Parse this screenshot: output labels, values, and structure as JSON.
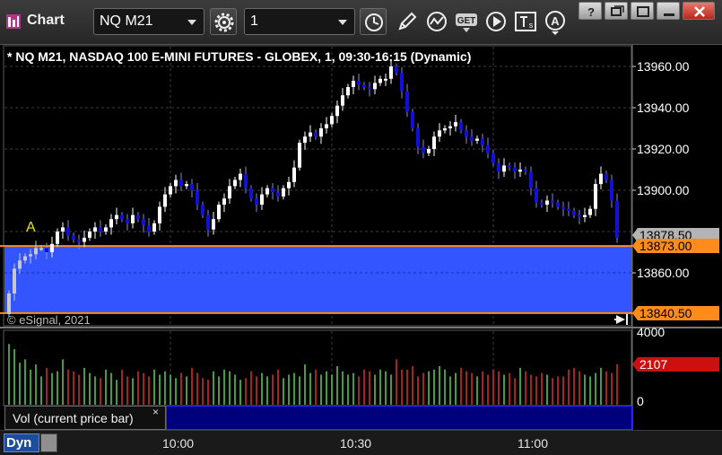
{
  "window": {
    "title": "Chart",
    "symbol": "NQ M21",
    "interval": "1"
  },
  "toolbar": {
    "icons": [
      "gear-icon",
      "clock-icon",
      "pencil-icon",
      "study-icon",
      "get-icon",
      "play-icon",
      "text-icon",
      "alert-icon"
    ]
  },
  "chart": {
    "title": "* NQ M21, NASDAQ 100 E-MINI FUTURES - GLOBEX, 1, 09:30-16:15 (Dynamic)",
    "copyright": "© eSignal, 2021",
    "annotation": "A",
    "price_labels": [
      "13960.00",
      "13940.00",
      "13920.00",
      "13900.00",
      "13860.00"
    ],
    "last_price": "13878.50",
    "line_price_1": "13873.00",
    "line_price_2": "13840.50",
    "volume_labels": [
      "4000",
      "0"
    ],
    "last_volume": "2107",
    "time_labels": [
      "10:00",
      "10:30",
      "11:00"
    ],
    "colors": {
      "up": "#ffffff",
      "down": "#1010d8",
      "zone": "#3355ff",
      "line": "#ff8c1a",
      "vol_up": "#5ad05a",
      "vol_down": "#d83030"
    }
  },
  "study": {
    "label": "Vol (current price bar)",
    "close": "×"
  },
  "status": {
    "mode": "Dyn"
  },
  "chart_data": {
    "type": "candlestick",
    "title": "* NQ M21, NASDAQ 100 E-MINI FUTURES - GLOBEX, 1, 09:30-16:15 (Dynamic)",
    "ylim": [
      13838,
      13967
    ],
    "y_ticks": [
      13960,
      13940,
      13920,
      13900,
      13860
    ],
    "x_ticks": [
      "10:00",
      "10:30",
      "11:00"
    ],
    "start_time": "09:30",
    "horizontal_lines": [
      13873.0,
      13840.5
    ],
    "shaded_zone": [
      13840.5,
      13873.0
    ],
    "last_price": 13878.5,
    "close": [
      13850,
      13862,
      13866,
      13868,
      13869,
      13872,
      13872,
      13870,
      13874,
      13880,
      13882,
      13878,
      13876,
      13875,
      13877,
      13880,
      13882,
      13880,
      13882,
      13886,
      13888,
      13886,
      13884,
      13888,
      13886,
      13883,
      13880,
      13884,
      13892,
      13898,
      13902,
      13905,
      13902,
      13903,
      13900,
      13893,
      13888,
      13881,
      13886,
      13893,
      13896,
      13902,
      13905,
      13908,
      13901,
      13896,
      13893,
      13898,
      13901,
      13899,
      13897,
      13901,
      13904,
      13911,
      13923,
      13926,
      13928,
      13926,
      13930,
      13932,
      13936,
      13941,
      13946,
      13950,
      13953,
      13951,
      13950,
      13949,
      13952,
      13954,
      13954,
      13960,
      13957,
      13948,
      13938,
      13930,
      13921,
      13918,
      13920,
      13926,
      13929,
      13930,
      13931,
      13933,
      13929,
      13926,
      13924,
      13925,
      13922,
      13918,
      13913,
      13909,
      13912,
      13911,
      13909,
      13910,
      13909,
      13901,
      13894,
      13893,
      13895,
      13894,
      13892,
      13891,
      13890,
      13888,
      13887,
      13888,
      13891,
      13903,
      13908,
      13905,
      13895,
      13877
    ],
    "volume_ylim": [
      0,
      4000
    ],
    "last_volume": 2107,
    "volume": [
      3300,
      3000,
      2200,
      2400,
      1800,
      2100,
      1400,
      1900,
      1600,
      1700,
      2400,
      1800,
      1700,
      1500,
      1900,
      1600,
      1400,
      1300,
      1800,
      1600,
      1200,
      1800,
      1400,
      1300,
      1700,
      1600,
      1400,
      1800,
      1500,
      1700,
      1500,
      1300,
      1600,
      1400,
      1900,
      1600,
      1300,
      1200,
      1700,
      1400,
      1800,
      1700,
      1500,
      1200,
      1300,
      1700,
      1400,
      1600,
      1400,
      1500,
      1800,
      1300,
      1500,
      1600,
      1400,
      2100,
      1600,
      1800,
      1500,
      1700,
      1500,
      2000,
      1700,
      1500,
      1600,
      1400,
      1800,
      1700,
      1500,
      1800,
      1700,
      1500,
      2400,
      1800,
      1800,
      2000,
      1400,
      1600,
      1700,
      1800,
      2000,
      1800,
      1400,
      1600,
      1900,
      1700,
      1600,
      1400,
      1700,
      1500,
      1800,
      1700,
      1500,
      1600,
      1300,
      1900,
      1700,
      1500,
      1400,
      1600,
      1500,
      1300,
      1400,
      1400,
      1800,
      1900,
      1700,
      1500,
      1400,
      1600,
      1900,
      1700,
      1600,
      2107
    ]
  }
}
